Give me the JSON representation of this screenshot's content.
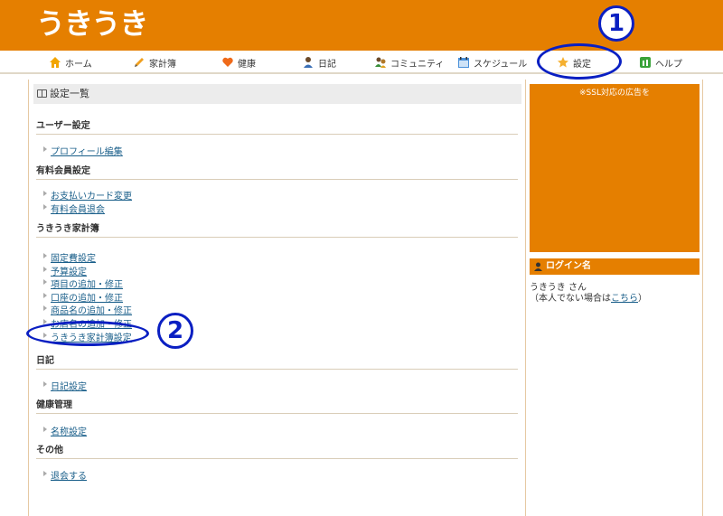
{
  "header": {
    "logo": "うきうき"
  },
  "nav": {
    "items": [
      {
        "label": "ホーム",
        "icon": "home-icon"
      },
      {
        "label": "家計簿",
        "icon": "pencil-icon"
      },
      {
        "label": "健康",
        "icon": "heart-icon"
      },
      {
        "label": "日記",
        "icon": "person-icon"
      },
      {
        "label": "コミュニティ",
        "icon": "community-icon"
      },
      {
        "label": "スケジュール",
        "icon": "calendar-icon"
      },
      {
        "label": "設定",
        "icon": "star-icon"
      },
      {
        "label": "ヘルプ",
        "icon": "help-icon"
      }
    ]
  },
  "markers": {
    "one": "1",
    "two": "2"
  },
  "main": {
    "title": "設定一覧",
    "sections": [
      {
        "heading": "ユーザー設定",
        "links": [
          "プロフィール編集"
        ]
      },
      {
        "heading": "有料会員設定",
        "links": [
          "お支払いカード変更",
          "有料会員退会"
        ]
      },
      {
        "heading": "うきうき家計簿",
        "links": [
          "固定費設定",
          "予算設定",
          "項目の追加・修正",
          "口座の追加・修正",
          "商品名の追加・修正",
          "お店名の追加・修正",
          "うきうき家計簿設定"
        ]
      },
      {
        "heading": "日記",
        "links": [
          "日記設定"
        ]
      },
      {
        "heading": "健康管理",
        "links": [
          "名称設定"
        ]
      },
      {
        "heading": "その他",
        "links": [
          "退会する"
        ]
      }
    ]
  },
  "sidebar": {
    "ad_text": "※SSL対応の広告を",
    "login_heading": "ログイン名",
    "login_user": "うきうき さん",
    "login_note_prefix": "（本人でない場合は",
    "login_note_link": "こちら",
    "login_note_suffix": "）"
  },
  "colors": {
    "brand": "#e57f00",
    "marker": "#0a1fc2",
    "link": "#1a5f8a"
  }
}
